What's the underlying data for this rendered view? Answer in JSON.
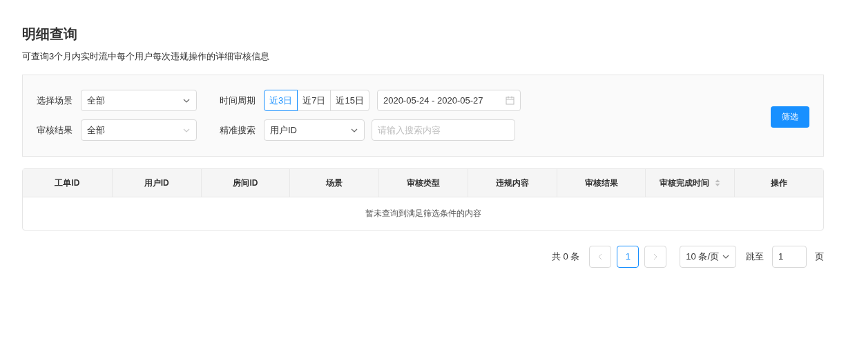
{
  "page": {
    "title": "明细查询",
    "subtitle": "可查询3个月内实时流中每个用户每次违规操作的详细审核信息"
  },
  "filters": {
    "scene": {
      "label": "选择场景",
      "value": "全部"
    },
    "result": {
      "label": "审核结果",
      "value": "全部"
    },
    "period": {
      "label": "时间周期",
      "options": [
        {
          "label": "近3日",
          "selected": true
        },
        {
          "label": "近7日",
          "selected": false
        },
        {
          "label": "近15日",
          "selected": false
        }
      ],
      "range": "2020-05-24 - 2020-05-27"
    },
    "search": {
      "label": "精准搜索",
      "type": "用户ID",
      "placeholder": "请输入搜索内容"
    },
    "submit": "筛选"
  },
  "table": {
    "columns": [
      {
        "label": "工单ID",
        "sortable": false
      },
      {
        "label": "用户ID",
        "sortable": false
      },
      {
        "label": "房间ID",
        "sortable": false
      },
      {
        "label": "场景",
        "sortable": false
      },
      {
        "label": "审核类型",
        "sortable": false
      },
      {
        "label": "违规内容",
        "sortable": false
      },
      {
        "label": "审核结果",
        "sortable": false
      },
      {
        "label": "审核完成时间",
        "sortable": true
      },
      {
        "label": "操作",
        "sortable": false
      }
    ],
    "empty": "暂未查询到满足筛选条件的内容"
  },
  "pagination": {
    "total": "共 0 条",
    "pages": [
      {
        "label": "1",
        "selected": true
      }
    ],
    "page_size": "10 条/页",
    "jump_label": "跳至",
    "jump_value": "1",
    "jump_suffix": "页"
  }
}
